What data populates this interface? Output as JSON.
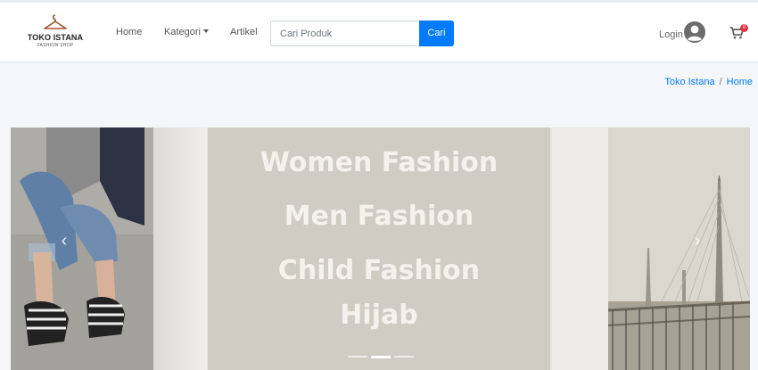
{
  "brand": {
    "name": "TOKO ISTANA",
    "tagline": "FASHION SHOP"
  },
  "nav": {
    "home": "Home",
    "kategori": "Kategori",
    "artikel": "Artikel"
  },
  "search": {
    "placeholder": "Cari Produk",
    "value": "",
    "button_label": "Cari"
  },
  "user": {
    "login_label": "Login"
  },
  "cart": {
    "badge": "0"
  },
  "breadcrumb": {
    "items": [
      "Toko Istana",
      "Home"
    ]
  },
  "carousel": {
    "lines": [
      "Women Fashion",
      "Men Fashion",
      "Child Fashion",
      "Hijab"
    ],
    "active_index": 1,
    "slide_count": 3
  },
  "colors": {
    "primary": "#007bff",
    "badge": "#dc3545",
    "slide_bg": "#cfcdc3",
    "slide_text": "#f3f2ec"
  },
  "icons": {
    "brand": "hanger-icon",
    "user": "user-circle-icon",
    "cart": "shopping-cart-icon",
    "prev": "chevron-left-icon",
    "next": "chevron-right-icon"
  }
}
